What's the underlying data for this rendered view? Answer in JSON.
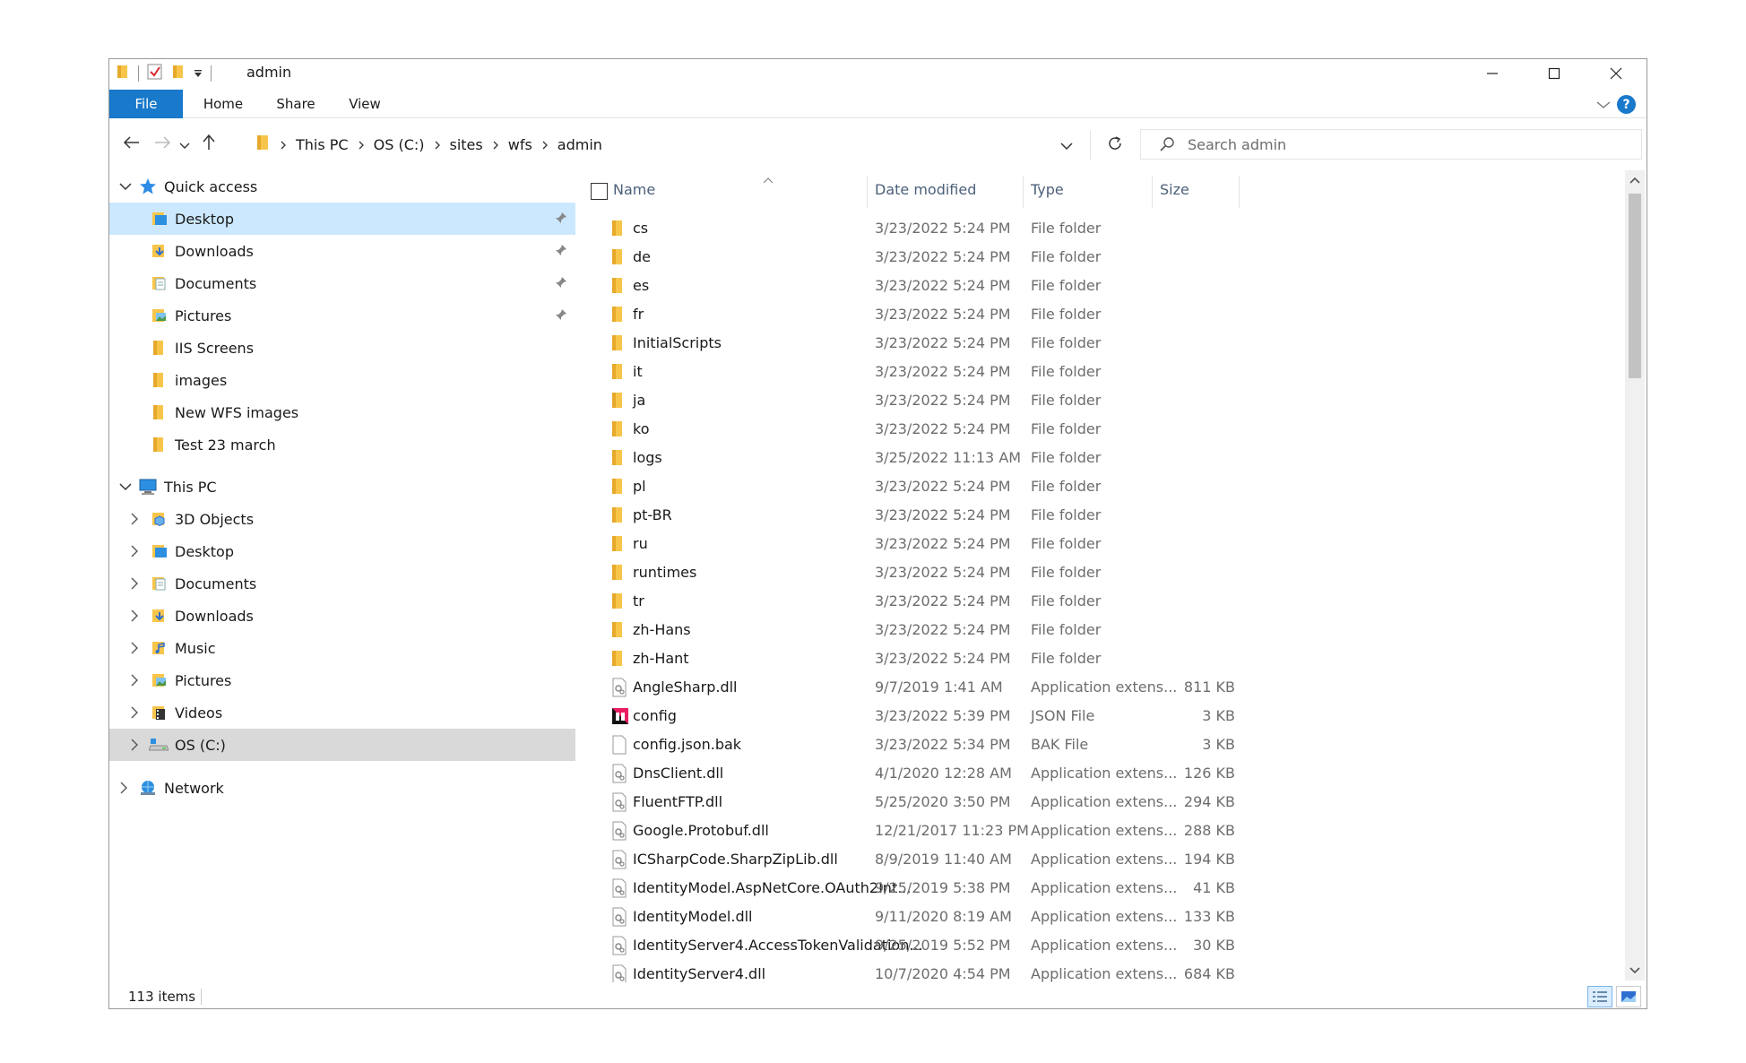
{
  "window": {
    "title": "admin"
  },
  "ribbon": {
    "tabs": [
      "File",
      "Home",
      "Share",
      "View"
    ]
  },
  "address": {
    "crumbs": [
      "This PC",
      "OS (C:)",
      "sites",
      "wfs",
      "admin"
    ]
  },
  "search": {
    "placeholder": "Search admin"
  },
  "nav": {
    "quick_access": "Quick access",
    "quick_items": [
      "Desktop",
      "Downloads",
      "Documents",
      "Pictures",
      "IIS Screens",
      "images",
      "New WFS images",
      "Test 23 march"
    ],
    "this_pc": "This PC",
    "pc_items": [
      "3D Objects",
      "Desktop",
      "Documents",
      "Downloads",
      "Music",
      "Pictures",
      "Videos",
      "OS (C:)"
    ],
    "network": "Network"
  },
  "columns": {
    "name": "Name",
    "date": "Date modified",
    "type": "Type",
    "size": "Size"
  },
  "files": [
    {
      "name": "cs",
      "date": "3/23/2022 5:24 PM",
      "type": "File folder",
      "size": "",
      "icon": "folder"
    },
    {
      "name": "de",
      "date": "3/23/2022 5:24 PM",
      "type": "File folder",
      "size": "",
      "icon": "folder"
    },
    {
      "name": "es",
      "date": "3/23/2022 5:24 PM",
      "type": "File folder",
      "size": "",
      "icon": "folder"
    },
    {
      "name": "fr",
      "date": "3/23/2022 5:24 PM",
      "type": "File folder",
      "size": "",
      "icon": "folder"
    },
    {
      "name": "InitialScripts",
      "date": "3/23/2022 5:24 PM",
      "type": "File folder",
      "size": "",
      "icon": "folder"
    },
    {
      "name": "it",
      "date": "3/23/2022 5:24 PM",
      "type": "File folder",
      "size": "",
      "icon": "folder"
    },
    {
      "name": "ja",
      "date": "3/23/2022 5:24 PM",
      "type": "File folder",
      "size": "",
      "icon": "folder"
    },
    {
      "name": "ko",
      "date": "3/23/2022 5:24 PM",
      "type": "File folder",
      "size": "",
      "icon": "folder"
    },
    {
      "name": "logs",
      "date": "3/25/2022 11:13 AM",
      "type": "File folder",
      "size": "",
      "icon": "folder"
    },
    {
      "name": "pl",
      "date": "3/23/2022 5:24 PM",
      "type": "File folder",
      "size": "",
      "icon": "folder"
    },
    {
      "name": "pt-BR",
      "date": "3/23/2022 5:24 PM",
      "type": "File folder",
      "size": "",
      "icon": "folder"
    },
    {
      "name": "ru",
      "date": "3/23/2022 5:24 PM",
      "type": "File folder",
      "size": "",
      "icon": "folder"
    },
    {
      "name": "runtimes",
      "date": "3/23/2022 5:24 PM",
      "type": "File folder",
      "size": "",
      "icon": "folder"
    },
    {
      "name": "tr",
      "date": "3/23/2022 5:24 PM",
      "type": "File folder",
      "size": "",
      "icon": "folder"
    },
    {
      "name": "zh-Hans",
      "date": "3/23/2022 5:24 PM",
      "type": "File folder",
      "size": "",
      "icon": "folder"
    },
    {
      "name": "zh-Hant",
      "date": "3/23/2022 5:24 PM",
      "type": "File folder",
      "size": "",
      "icon": "folder"
    },
    {
      "name": "AngleSharp.dll",
      "date": "9/7/2019 1:41 AM",
      "type": "Application extens...",
      "size": "811 KB",
      "icon": "dll"
    },
    {
      "name": "config",
      "date": "3/23/2022 5:39 PM",
      "type": "JSON File",
      "size": "3 KB",
      "icon": "json"
    },
    {
      "name": "config.json.bak",
      "date": "3/23/2022 5:34 PM",
      "type": "BAK File",
      "size": "3 KB",
      "icon": "blank"
    },
    {
      "name": "DnsClient.dll",
      "date": "4/1/2020 12:28 AM",
      "type": "Application extens...",
      "size": "126 KB",
      "icon": "dll"
    },
    {
      "name": "FluentFTP.dll",
      "date": "5/25/2020 3:50 PM",
      "type": "Application extens...",
      "size": "294 KB",
      "icon": "dll"
    },
    {
      "name": "Google.Protobuf.dll",
      "date": "12/21/2017 11:23 PM",
      "type": "Application extens...",
      "size": "288 KB",
      "icon": "dll"
    },
    {
      "name": "ICSharpCode.SharpZipLib.dll",
      "date": "8/9/2019 11:40 AM",
      "type": "Application extens...",
      "size": "194 KB",
      "icon": "dll"
    },
    {
      "name": "IdentityModel.AspNetCore.OAuth2Int...",
      "date": "9/25/2019 5:38 PM",
      "type": "Application extens...",
      "size": "41 KB",
      "icon": "dll"
    },
    {
      "name": "IdentityModel.dll",
      "date": "9/11/2020 8:19 AM",
      "type": "Application extens...",
      "size": "133 KB",
      "icon": "dll"
    },
    {
      "name": "IdentityServer4.AccessTokenValidation...",
      "date": "9/25/2019 5:52 PM",
      "type": "Application extens...",
      "size": "30 KB",
      "icon": "dll"
    },
    {
      "name": "IdentityServer4.dll",
      "date": "10/7/2020 4:54 PM",
      "type": "Application extens...",
      "size": "684 KB",
      "icon": "dll"
    }
  ],
  "status": {
    "count": "113 items"
  },
  "colors": {
    "accent": "#1979ca",
    "folder": "#f8c54b",
    "selection": "#cce8ff"
  }
}
